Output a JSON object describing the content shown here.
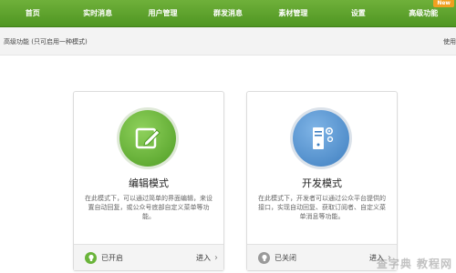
{
  "nav": {
    "items": [
      {
        "label": "首页"
      },
      {
        "label": "实时消息"
      },
      {
        "label": "用户管理"
      },
      {
        "label": "群发消息"
      },
      {
        "label": "素材管理"
      },
      {
        "label": "设置"
      },
      {
        "label": "高级功能",
        "badge": "New"
      }
    ]
  },
  "subbar": {
    "title": "高级功能 (只可启用一种模式)",
    "help": "使用"
  },
  "cards": [
    {
      "title": "编辑模式",
      "desc": "在此模式下，可以通过简单的界面编辑，来设置自动回复，或公众号底部自定义菜单等功能。",
      "status": "已开启",
      "enter": "进入",
      "icon": "edit-icon"
    },
    {
      "title": "开发模式",
      "desc": "在此模式下，开发者可以通过公众平台提供的接口，实现自动回复、获取订阅者、自定义菜单消息等功能。",
      "status": "已关闭",
      "enter": "进入",
      "icon": "server-settings-icon"
    }
  ],
  "watermark": "查字典 教程网",
  "colors": {
    "nav_green": "#5aa22c",
    "status_on": "#6ab43a",
    "status_off": "#9a9a9a"
  }
}
